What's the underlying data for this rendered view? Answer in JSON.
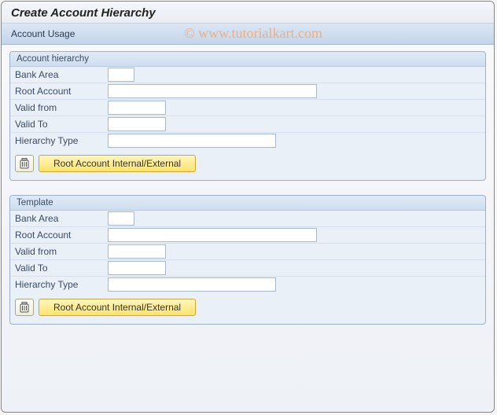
{
  "title": "Create Account Hierarchy",
  "toolbar": {
    "account_usage_label": "Account Usage"
  },
  "watermark": "©  www.tutorialkart.com",
  "groups": {
    "hierarchy": {
      "title": "Account hierarchy",
      "fields": {
        "bank_area": {
          "label": "Bank Area",
          "value": ""
        },
        "root_account": {
          "label": "Root Account",
          "value": ""
        },
        "valid_from": {
          "label": "Valid from",
          "value": ""
        },
        "valid_to": {
          "label": "Valid To",
          "value": ""
        },
        "hierarchy_type": {
          "label": "Hierarchy Type",
          "value": ""
        }
      },
      "button_label": "Root Account Internal/External"
    },
    "template": {
      "title": "Template",
      "fields": {
        "bank_area": {
          "label": "Bank Area",
          "value": ""
        },
        "root_account": {
          "label": "Root Account",
          "value": ""
        },
        "valid_from": {
          "label": "Valid from",
          "value": ""
        },
        "valid_to": {
          "label": "Valid To",
          "value": ""
        },
        "hierarchy_type": {
          "label": "Hierarchy Type",
          "value": ""
        }
      },
      "button_label": "Root Account Internal/External"
    }
  },
  "icons": {
    "trash": "trash-icon"
  }
}
